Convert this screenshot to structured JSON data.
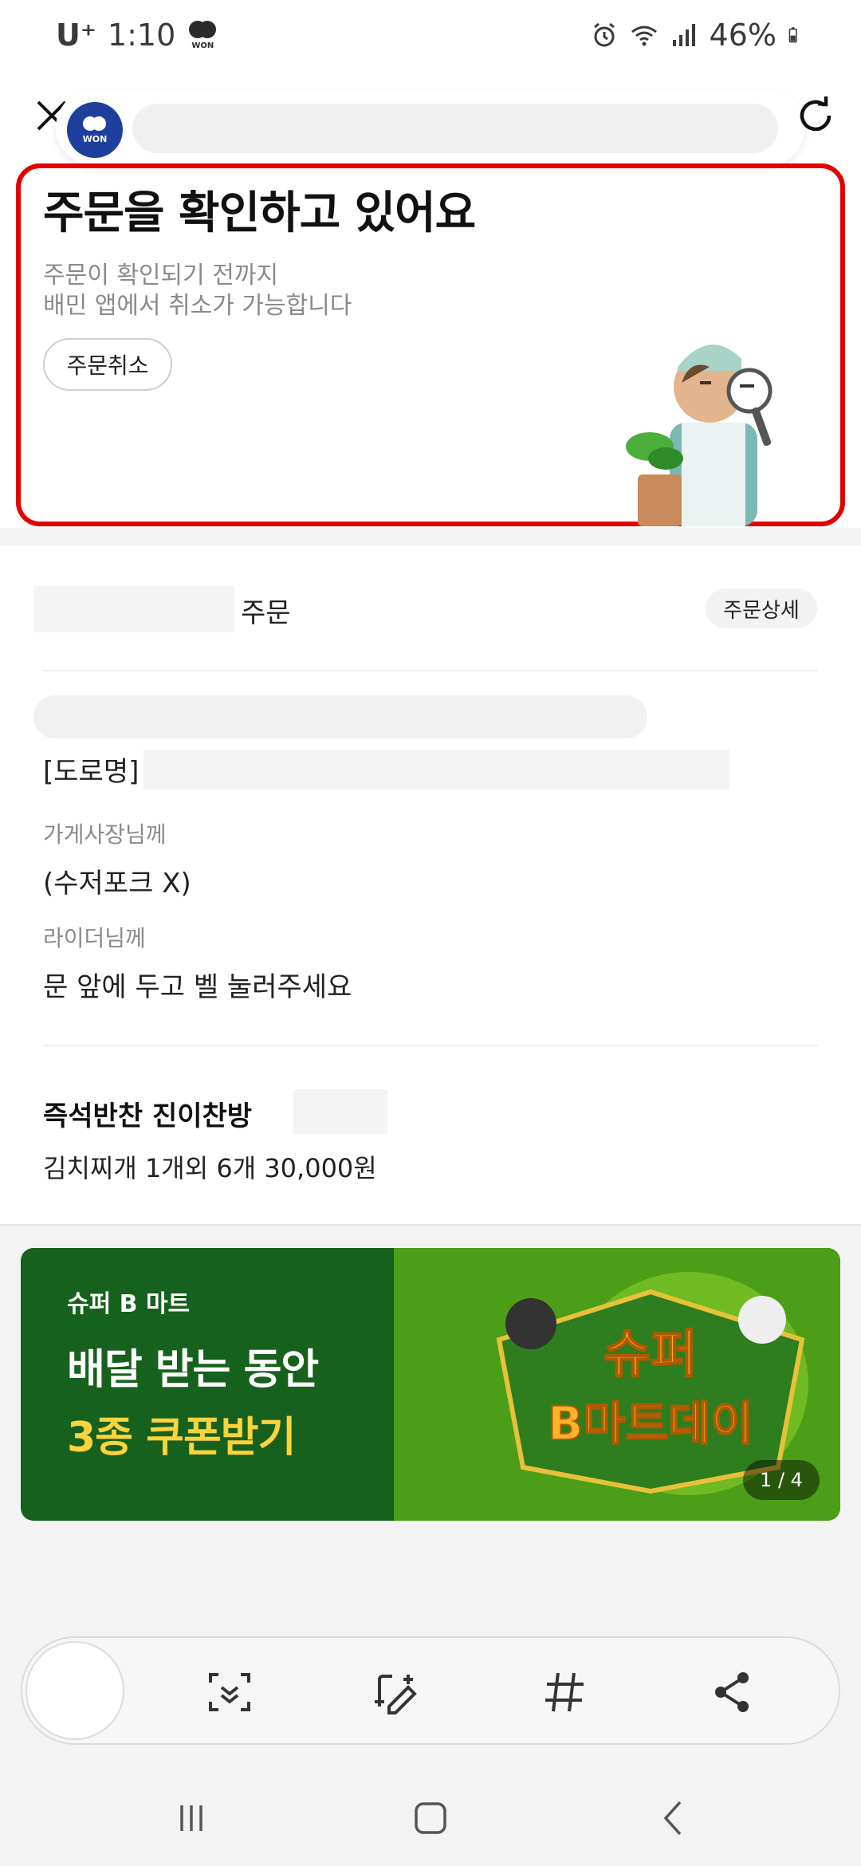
{
  "status_bar": {
    "carrier": "U⁺",
    "time": "1:10",
    "won_badge": "WON",
    "battery_percent": "46%",
    "icons": [
      "won-icon",
      "alarm-icon",
      "wifi-icon",
      "signal-icon",
      "battery-icon"
    ]
  },
  "browser": {
    "logo_text": "WON",
    "close_icon": "close-icon",
    "refresh_icon": "refresh-icon"
  },
  "header": {
    "title": "주문을 확인하고 있어요",
    "subtitle_line1": "주문이 확인되기 전까지",
    "subtitle_line2": "배민 앱에서 취소가 가능합니다",
    "cancel_button": "주문취소",
    "highlight_color": "#e30000"
  },
  "order": {
    "label": "주문",
    "detail_button": "주문상세",
    "road_label": "[도로명]",
    "owner_label": "가게사장님께",
    "owner_value": "(수저포크 X)",
    "rider_label": "라이더님께",
    "rider_value": "문 앞에 두고 벨 눌러주세요",
    "store_name": "즉석반찬 진이찬방",
    "menu_summary": "김치찌개 1개외 6개 30,000원"
  },
  "banner": {
    "brand": "슈퍼 B 마트",
    "line1": "배달 받는 동안",
    "line2": "3종 쿠폰받기",
    "art_text_top": "슈퍼",
    "art_text_bottom": "B마트데이",
    "pager": "1 / 4",
    "bg_color": "#17611f",
    "accent_color": "#ffd33a"
  },
  "toolbar": {
    "items": [
      "scan-text-icon",
      "edit-image-icon",
      "hashtag-icon",
      "share-icon"
    ]
  },
  "navbar": {
    "items": [
      "recent-apps-icon",
      "home-icon",
      "back-icon"
    ]
  }
}
